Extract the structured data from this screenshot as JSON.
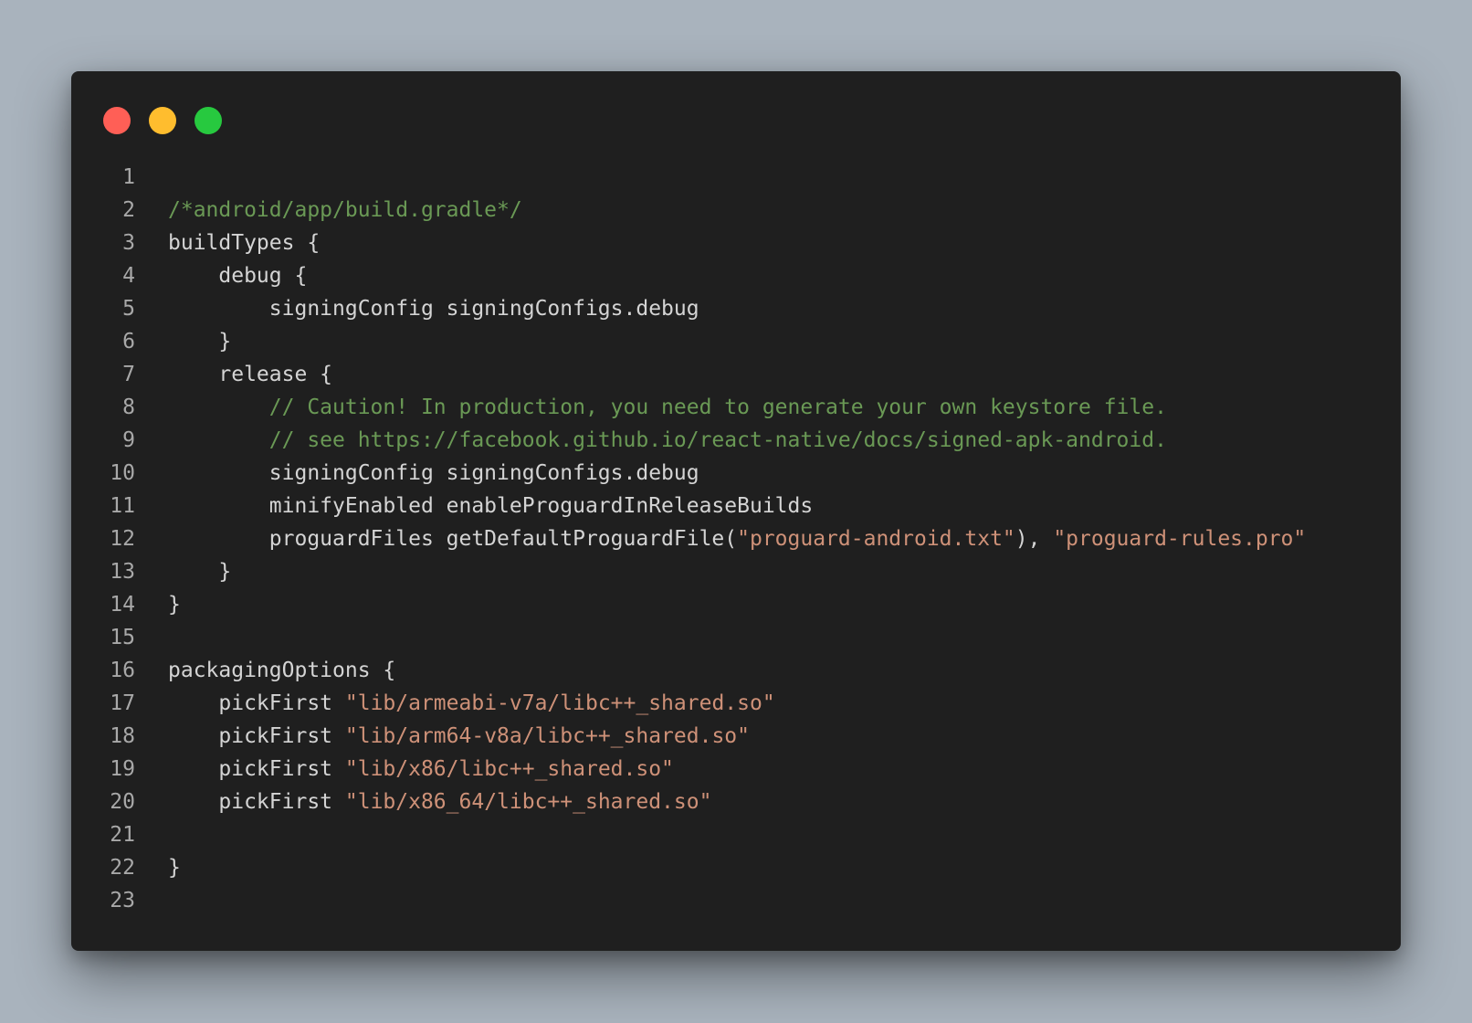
{
  "window": {
    "traffic_lights": [
      {
        "name": "close",
        "color": "#ff5f56"
      },
      {
        "name": "minimize",
        "color": "#ffbd2e"
      },
      {
        "name": "zoom",
        "color": "#27c93f"
      }
    ]
  },
  "colors": {
    "background": "#a9b3bd",
    "editor_bg": "#1f1f1f",
    "text": "#d4d4d4",
    "comment": "#6a9955",
    "string": "#ce9178",
    "line_number": "#a8a8a8"
  },
  "code": {
    "lines": [
      {
        "number": "1",
        "tokens": []
      },
      {
        "number": "2",
        "tokens": [
          {
            "type": "comment",
            "text": "/*android/app/build.gradle*/"
          }
        ]
      },
      {
        "number": "3",
        "tokens": [
          {
            "type": "plain",
            "text": "buildTypes {"
          }
        ]
      },
      {
        "number": "4",
        "tokens": [
          {
            "type": "plain",
            "text": "    debug {"
          }
        ]
      },
      {
        "number": "5",
        "tokens": [
          {
            "type": "plain",
            "text": "        signingConfig signingConfigs.debug"
          }
        ]
      },
      {
        "number": "6",
        "tokens": [
          {
            "type": "plain",
            "text": "    }"
          }
        ]
      },
      {
        "number": "7",
        "tokens": [
          {
            "type": "plain",
            "text": "    release {"
          }
        ]
      },
      {
        "number": "8",
        "tokens": [
          {
            "type": "plain",
            "text": "        "
          },
          {
            "type": "comment",
            "text": "// Caution! In production, you need to generate your own keystore file."
          }
        ]
      },
      {
        "number": "9",
        "tokens": [
          {
            "type": "plain",
            "text": "        "
          },
          {
            "type": "comment",
            "text": "// see https://facebook.github.io/react-native/docs/signed-apk-android."
          }
        ]
      },
      {
        "number": "10",
        "tokens": [
          {
            "type": "plain",
            "text": "        signingConfig signingConfigs.debug"
          }
        ]
      },
      {
        "number": "11",
        "tokens": [
          {
            "type": "plain",
            "text": "        minifyEnabled enableProguardInReleaseBuilds"
          }
        ]
      },
      {
        "number": "12",
        "tokens": [
          {
            "type": "plain",
            "text": "        proguardFiles getDefaultProguardFile("
          },
          {
            "type": "string",
            "text": "\"proguard-android.txt\""
          },
          {
            "type": "plain",
            "text": "), "
          },
          {
            "type": "string",
            "text": "\"proguard-rules.pro\""
          }
        ]
      },
      {
        "number": "13",
        "tokens": [
          {
            "type": "plain",
            "text": "    }"
          }
        ]
      },
      {
        "number": "14",
        "tokens": [
          {
            "type": "plain",
            "text": "}"
          }
        ]
      },
      {
        "number": "15",
        "tokens": []
      },
      {
        "number": "16",
        "tokens": [
          {
            "type": "plain",
            "text": "packagingOptions {"
          }
        ]
      },
      {
        "number": "17",
        "tokens": [
          {
            "type": "plain",
            "text": "    pickFirst "
          },
          {
            "type": "string",
            "text": "\"lib/armeabi-v7a/libc++_shared.so\""
          }
        ]
      },
      {
        "number": "18",
        "tokens": [
          {
            "type": "plain",
            "text": "    pickFirst "
          },
          {
            "type": "string",
            "text": "\"lib/arm64-v8a/libc++_shared.so\""
          }
        ]
      },
      {
        "number": "19",
        "tokens": [
          {
            "type": "plain",
            "text": "    pickFirst "
          },
          {
            "type": "string",
            "text": "\"lib/x86/libc++_shared.so\""
          }
        ]
      },
      {
        "number": "20",
        "tokens": [
          {
            "type": "plain",
            "text": "    pickFirst "
          },
          {
            "type": "string",
            "text": "\"lib/x86_64/libc++_shared.so\""
          }
        ]
      },
      {
        "number": "21",
        "tokens": []
      },
      {
        "number": "22",
        "tokens": [
          {
            "type": "plain",
            "text": "}"
          }
        ]
      },
      {
        "number": "23",
        "tokens": []
      }
    ]
  }
}
